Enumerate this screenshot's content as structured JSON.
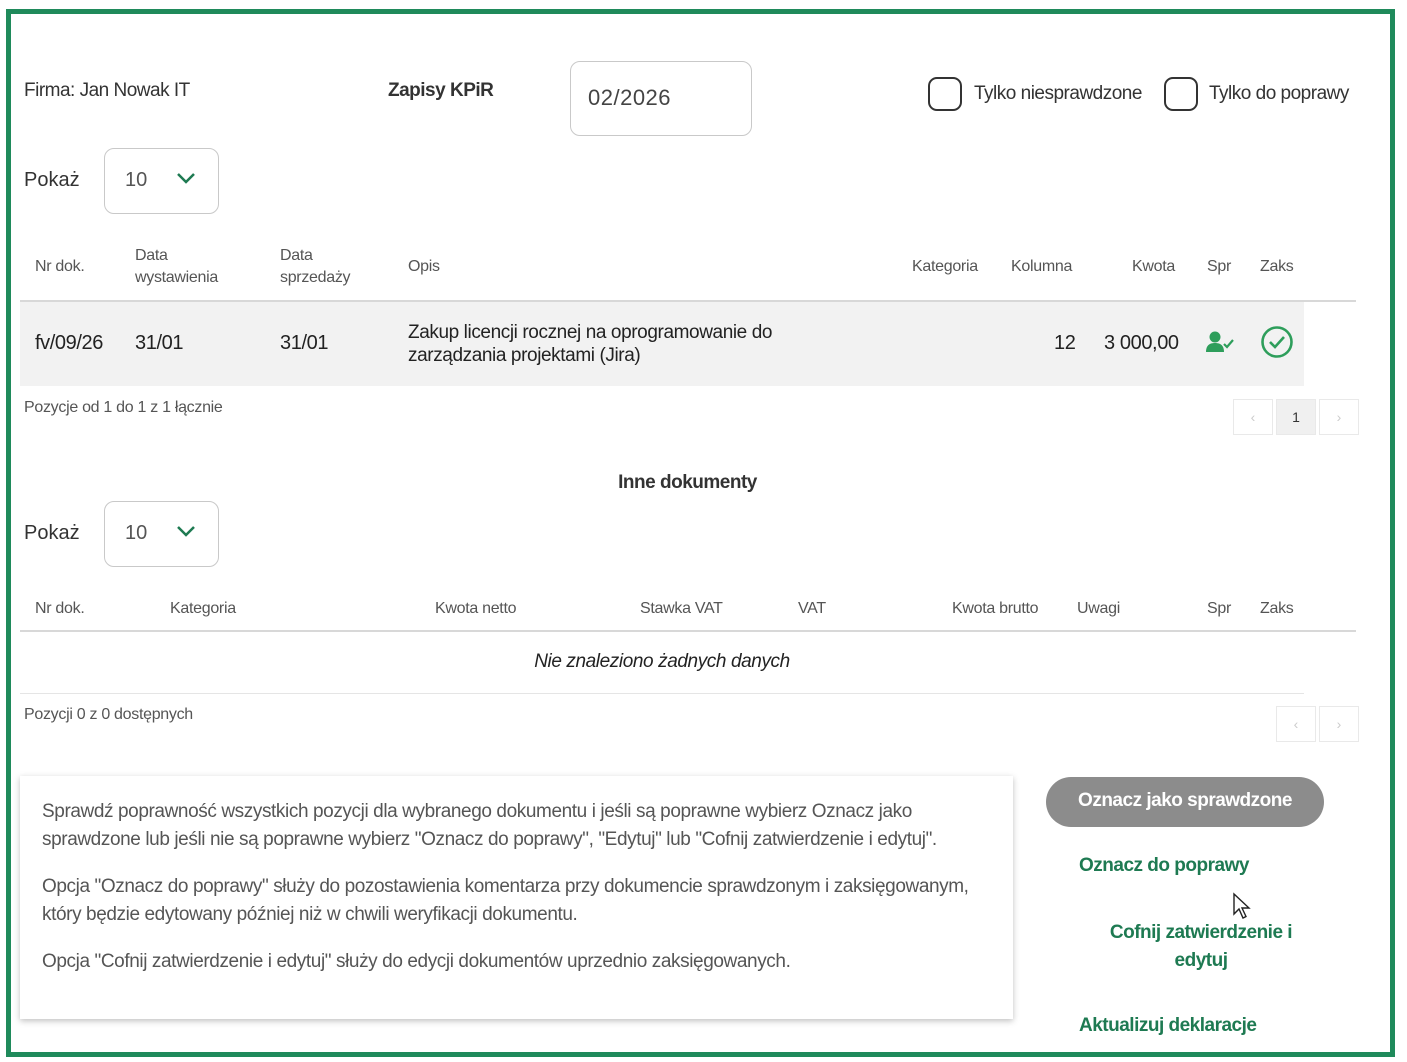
{
  "header": {
    "firma": "Firma: Jan Nowak IT",
    "title": "Zapisy KPiR",
    "period": "02/2026",
    "filter_unchecked_label": "Tylko niesprawdzone",
    "filter_fix_label": "Tylko do poprawy"
  },
  "kpir": {
    "show_label": "Pokaż",
    "page_size": "10",
    "columns": [
      "Nr dok.",
      "Data wystawienia",
      "Data sprzedaży",
      "Opis",
      "Kategoria",
      "Kolumna",
      "Kwota",
      "Spr",
      "Zaks"
    ],
    "rows": [
      {
        "nr": "fv/09/26",
        "data_wystawienia": "31/01",
        "data_sprzedazy": "31/01",
        "opis": "Zakup licencji rocznej na oprogramowanie do zarządzania projektami (Jira)",
        "kategoria": "",
        "kolumna": "12",
        "kwota": "3 000,00"
      }
    ],
    "info": "Pozycje od 1 do 1 z 1 łącznie",
    "pagination": {
      "prev": "‹",
      "current": "1",
      "next": "›"
    }
  },
  "inne": {
    "title": "Inne dokumenty",
    "show_label": "Pokaż",
    "page_size": "10",
    "columns": [
      "Nr dok.",
      "Kategoria",
      "Kwota netto",
      "Stawka VAT",
      "VAT",
      "Kwota brutto",
      "Uwagi",
      "Spr",
      "Zaks"
    ],
    "empty": "Nie znaleziono żadnych danych",
    "info": "Pozycji 0 z 0 dostępnych",
    "pagination": {
      "prev": "‹",
      "next": "›"
    }
  },
  "infobox": {
    "p1": "Sprawdź poprawność wszystkich pozycji dla wybranego dokumentu i jeśli są poprawne wybierz Oznacz jako sprawdzone lub jeśli nie są poprawne wybierz \"Oznacz do poprawy\", \"Edytuj\" lub \"Cofnij zatwierdzenie i edytuj\".",
    "p2": "Opcja \"Oznacz do poprawy\" służy do pozostawienia komentarza przy dokumencie sprawdzonym i zaksięgowanym, który będzie edytowany później niż w chwili weryfikacji dokumentu.",
    "p3": "Opcja \"Cofnij zatwierdzenie i edytuj\" służy do edycji dokumentów uprzednio zaksięgowanych."
  },
  "actions": {
    "mark_checked": "Oznacz jako sprawdzone",
    "mark_fix": "Oznacz do poprawy",
    "undo_edit": "Cofnij zatwierdzenie i edytuj",
    "update_decl": "Aktualizuj deklaracje"
  },
  "colors": {
    "accent": "#1e7a52",
    "frame": "#1f8a5b",
    "button_grey": "#8c8c8c"
  },
  "icons": {
    "spr": "user-check-icon",
    "zaks": "check-circle-icon"
  }
}
